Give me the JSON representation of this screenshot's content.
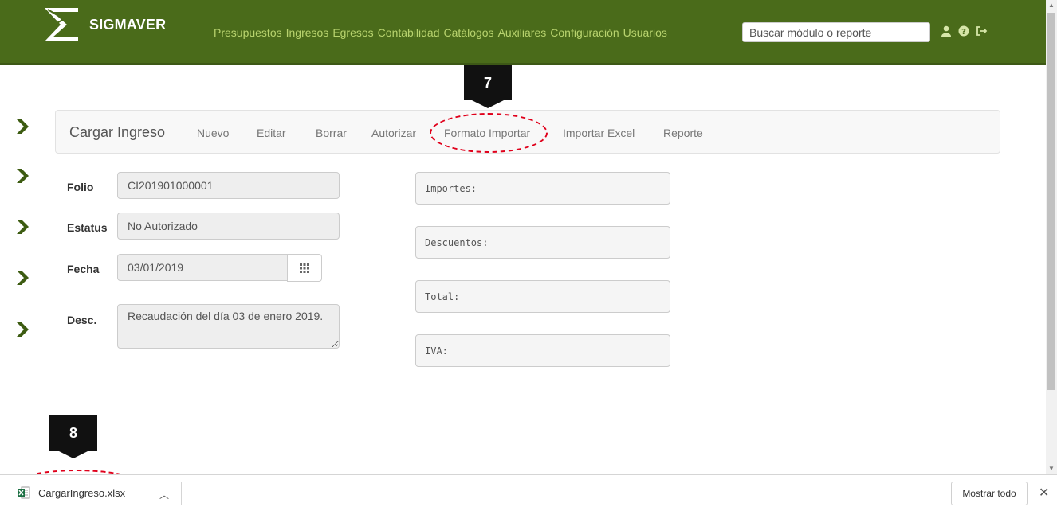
{
  "nav": {
    "brand": "SIGMAVER",
    "menu": [
      "Presupuestos",
      "Ingresos",
      "Egresos",
      "Contabilidad",
      "Catálogos",
      "Auxiliares",
      "Configuración",
      "Usuarios"
    ],
    "search_placeholder": "Buscar módulo o reporte",
    "icons": [
      "user-icon",
      "help-icon",
      "logout-icon"
    ],
    "accent": "#4a6b1a",
    "link_color": "#b8d36e"
  },
  "toolbar": {
    "title": "Cargar Ingreso",
    "items": [
      "Nuevo",
      "Editar",
      "Borrar",
      "Autorizar",
      "Formato Importar",
      "Importar Excel",
      "Reporte"
    ]
  },
  "form": {
    "folio": {
      "label": "Folio",
      "value": "CI201901000001"
    },
    "estatus": {
      "label": "Estatus",
      "value": "No Autorizado"
    },
    "fecha": {
      "label": "Fecha",
      "value": "03/01/2019"
    },
    "desc": {
      "label": "Desc.",
      "value": "Recaudación del día 03 de enero 2019."
    }
  },
  "totals": {
    "importes": "Importes:",
    "descuentos": "Descuentos:",
    "total": "Total:",
    "iva": "IVA:"
  },
  "callouts": {
    "step7": "7",
    "step8": "8"
  },
  "downloads": {
    "file_name": "CargarIngreso.xlsx",
    "show_all": "Mostrar todo",
    "close": "✕"
  }
}
